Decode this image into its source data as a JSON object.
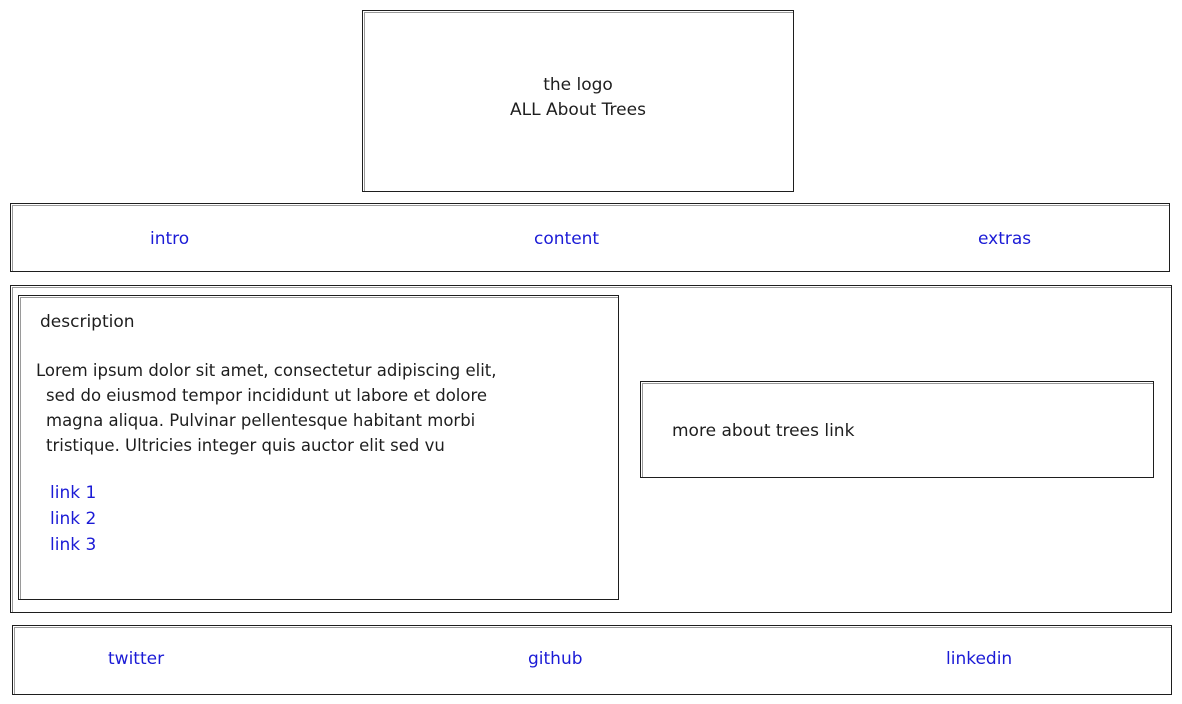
{
  "logo": {
    "line1": "the logo",
    "line2": "ALL About Trees"
  },
  "nav": {
    "items": [
      {
        "label": "intro"
      },
      {
        "label": "content"
      },
      {
        "label": "extras"
      }
    ]
  },
  "description": {
    "heading": "description",
    "paragraph_lines": [
      "Lorem ipsum dolor sit amet, consectetur adipiscing elit,",
      "sed do eiusmod tempor incididunt ut labore et dolore",
      "magna aliqua. Pulvinar pellentesque habitant morbi",
      "tristique. Ultricies integer quis auctor elit sed vu"
    ],
    "links": [
      {
        "label": "link 1"
      },
      {
        "label": "link 2"
      },
      {
        "label": "link 3"
      }
    ]
  },
  "side": {
    "more_link": "more about trees link"
  },
  "footer": {
    "links": [
      {
        "label": "twitter"
      },
      {
        "label": "github"
      },
      {
        "label": "linkedin"
      }
    ]
  },
  "colors": {
    "stroke": "#1e1e1e",
    "link": "#1b1bd6",
    "background": "#ffffff"
  }
}
